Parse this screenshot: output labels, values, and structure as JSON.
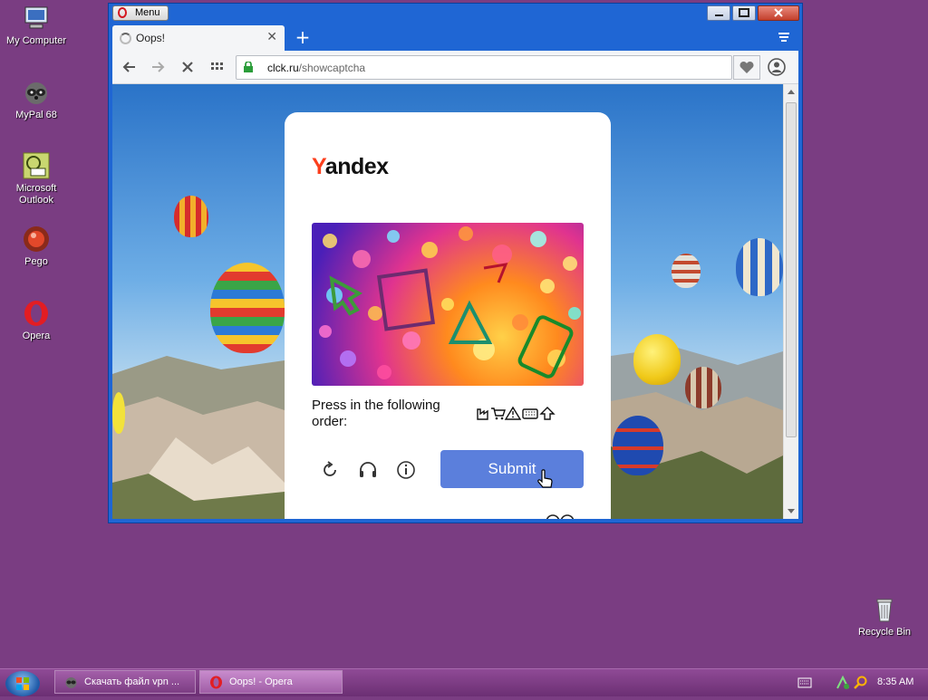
{
  "desktop": {
    "icons": [
      {
        "label": "My Computer"
      },
      {
        "label": "MyPal 68"
      },
      {
        "label": "Microsoft Outlook"
      },
      {
        "label": "Pego"
      },
      {
        "label": "Opera"
      },
      {
        "label": "Recycle Bin"
      }
    ]
  },
  "browser": {
    "menu_label": "Menu",
    "tab_title": "Oops!",
    "address": {
      "domain": "clck.ru",
      "path": "/showcaptcha"
    }
  },
  "captcha": {
    "logo_first": "Y",
    "logo_rest": "andex",
    "instruction": "Press in the following order:",
    "submit_label": "Submit",
    "order_icons": [
      "factory-icon",
      "cart-icon",
      "warning-triangle-icon",
      "keyboard-icon",
      "up-arrow-icon"
    ],
    "control_icons": [
      "refresh-icon",
      "headphones-icon",
      "info-icon"
    ]
  },
  "taskbar": {
    "tasks": [
      {
        "label": "Скачать файл vpn ..."
      },
      {
        "label": "Oops! - Opera"
      }
    ],
    "clock": "8:35 AM"
  },
  "colors": {
    "desktop_bg": "#7a3d82",
    "window_frame": "#1f66d4",
    "yandex_red": "#fc3f1d",
    "submit_blue": "#5b7fdc"
  }
}
